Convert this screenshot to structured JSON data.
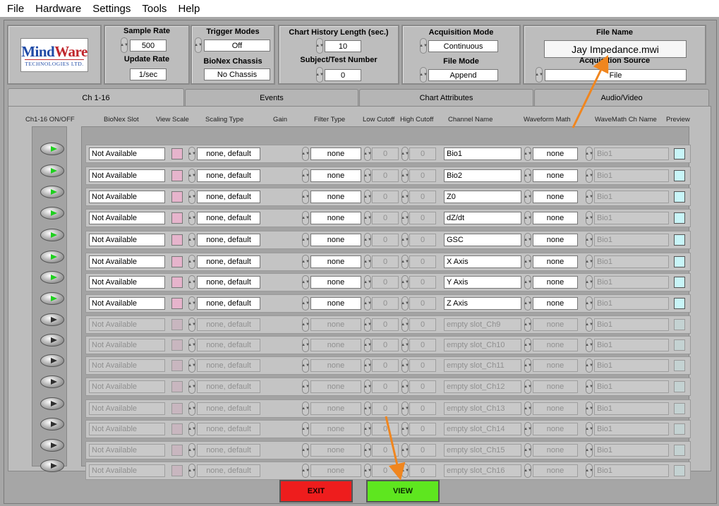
{
  "menu": [
    "File",
    "Hardware",
    "Settings",
    "Tools",
    "Help"
  ],
  "logo": {
    "main_left": "Mind",
    "main_right": "Ware",
    "sub": "TECHNOLOGIES LTD."
  },
  "sample_rate": {
    "label": "Sample Rate",
    "value": "500"
  },
  "update_rate": {
    "label": "Update Rate",
    "value": "1/sec"
  },
  "trigger_modes": {
    "label": "Trigger Modes",
    "value": "Off"
  },
  "bionex_chassis": {
    "label": "BioNex Chassis",
    "value": "No Chassis"
  },
  "chart_history": {
    "label": "Chart History Length (sec.)",
    "value": "10"
  },
  "subject_test": {
    "label": "Subject/Test Number",
    "value": "0"
  },
  "acquisition_mode": {
    "label": "Acquisition Mode",
    "value": "Continuous"
  },
  "file_mode": {
    "label": "File Mode",
    "value": "Append"
  },
  "file_name": {
    "label": "File Name",
    "value": "Jay Impedance.mwi"
  },
  "acquisition_source": {
    "label": "Acquisition Source",
    "value": "File"
  },
  "tabs": [
    "Ch 1-16",
    "Events",
    "Chart Attributes",
    "Audio/Video"
  ],
  "columns": {
    "onoff": "Ch1-16 ON/OFF",
    "bionex_slot": "BioNex Slot",
    "view_scale": "View Scale",
    "scaling_type": "Scaling Type",
    "gain": "Gain",
    "filter_type": "Filter Type",
    "low_cutoff": "Low Cutoff",
    "high_cutoff": "High Cutoff",
    "channel_name": "Channel Name",
    "waveform_math": "Waveform Math",
    "wavemath_ch_name": "WaveMath Ch Name",
    "preview": "Preview"
  },
  "channels": [
    {
      "on": true,
      "slot": "Not Available",
      "scaling": "none, default",
      "filter": "none",
      "low": "0",
      "high": "0",
      "name": "Bio1",
      "math": "none",
      "mathname": "Bio1"
    },
    {
      "on": true,
      "slot": "Not Available",
      "scaling": "none, default",
      "filter": "none",
      "low": "0",
      "high": "0",
      "name": "Bio2",
      "math": "none",
      "mathname": "Bio1"
    },
    {
      "on": true,
      "slot": "Not Available",
      "scaling": "none, default",
      "filter": "none",
      "low": "0",
      "high": "0",
      "name": "Z0",
      "math": "none",
      "mathname": "Bio1"
    },
    {
      "on": true,
      "slot": "Not Available",
      "scaling": "none, default",
      "filter": "none",
      "low": "0",
      "high": "0",
      "name": "dZ/dt",
      "math": "none",
      "mathname": "Bio1"
    },
    {
      "on": true,
      "slot": "Not Available",
      "scaling": "none, default",
      "filter": "none",
      "low": "0",
      "high": "0",
      "name": "GSC",
      "math": "none",
      "mathname": "Bio1"
    },
    {
      "on": true,
      "slot": "Not Available",
      "scaling": "none, default",
      "filter": "none",
      "low": "0",
      "high": "0",
      "name": "X Axis",
      "math": "none",
      "mathname": "Bio1"
    },
    {
      "on": true,
      "slot": "Not Available",
      "scaling": "none, default",
      "filter": "none",
      "low": "0",
      "high": "0",
      "name": "Y Axis",
      "math": "none",
      "mathname": "Bio1"
    },
    {
      "on": true,
      "slot": "Not Available",
      "scaling": "none, default",
      "filter": "none",
      "low": "0",
      "high": "0",
      "name": "Z Axis",
      "math": "none",
      "mathname": "Bio1"
    },
    {
      "on": false,
      "slot": "Not Available",
      "scaling": "none, default",
      "filter": "none",
      "low": "0",
      "high": "0",
      "name": "empty slot_Ch9",
      "math": "none",
      "mathname": "Bio1"
    },
    {
      "on": false,
      "slot": "Not Available",
      "scaling": "none, default",
      "filter": "none",
      "low": "0",
      "high": "0",
      "name": "empty slot_Ch10",
      "math": "none",
      "mathname": "Bio1"
    },
    {
      "on": false,
      "slot": "Not Available",
      "scaling": "none, default",
      "filter": "none",
      "low": "0",
      "high": "0",
      "name": "empty slot_Ch11",
      "math": "none",
      "mathname": "Bio1"
    },
    {
      "on": false,
      "slot": "Not Available",
      "scaling": "none, default",
      "filter": "none",
      "low": "0",
      "high": "0",
      "name": "empty slot_Ch12",
      "math": "none",
      "mathname": "Bio1"
    },
    {
      "on": false,
      "slot": "Not Available",
      "scaling": "none, default",
      "filter": "none",
      "low": "0",
      "high": "0",
      "name": "empty slot_Ch13",
      "math": "none",
      "mathname": "Bio1"
    },
    {
      "on": false,
      "slot": "Not Available",
      "scaling": "none, default",
      "filter": "none",
      "low": "0",
      "high": "0",
      "name": "empty slot_Ch14",
      "math": "none",
      "mathname": "Bio1"
    },
    {
      "on": false,
      "slot": "Not Available",
      "scaling": "none, default",
      "filter": "none",
      "low": "0",
      "high": "0",
      "name": "empty slot_Ch15",
      "math": "none",
      "mathname": "Bio1"
    },
    {
      "on": false,
      "slot": "Not Available",
      "scaling": "none, default",
      "filter": "none",
      "low": "0",
      "high": "0",
      "name": "empty slot_Ch16",
      "math": "none",
      "mathname": "Bio1"
    }
  ],
  "buttons": {
    "exit": "EXIT",
    "view": "VIEW"
  },
  "colors": {
    "exit": "#ee1d1d",
    "view": "#5ee61f",
    "annotation_arrow": "#f0861f",
    "view_scale": "#e6b4cc",
    "preview": "#c8f5f8",
    "led_on": "#1fd01f"
  }
}
